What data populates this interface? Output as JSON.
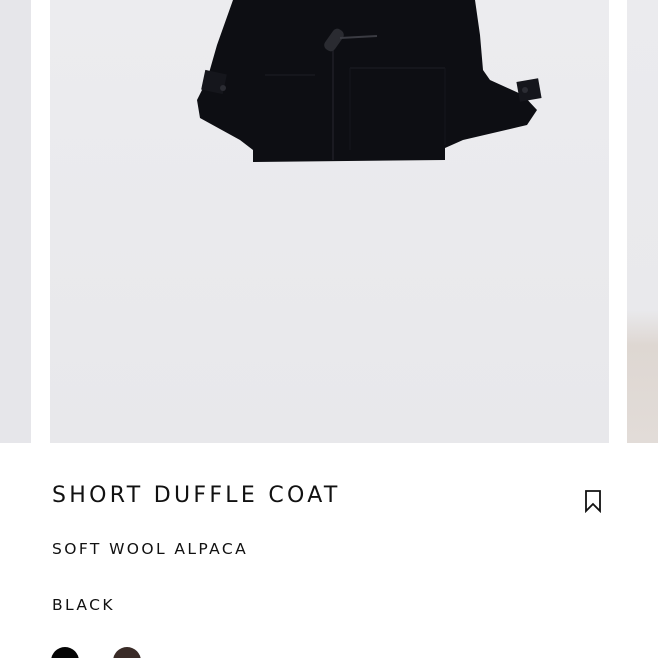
{
  "product": {
    "name": "SHORT DUFFLE COAT",
    "material": "SOFT WOOL ALPACA",
    "selected_color": "BLACK"
  },
  "colors": {
    "swatches": [
      {
        "hex": "#050505",
        "selected": true
      },
      {
        "hex": "#3a2b27",
        "selected": false
      }
    ],
    "background_photo": "#eaeaed",
    "coat": "#0e0f14"
  },
  "icons": {
    "bookmark": "bookmark-icon"
  }
}
